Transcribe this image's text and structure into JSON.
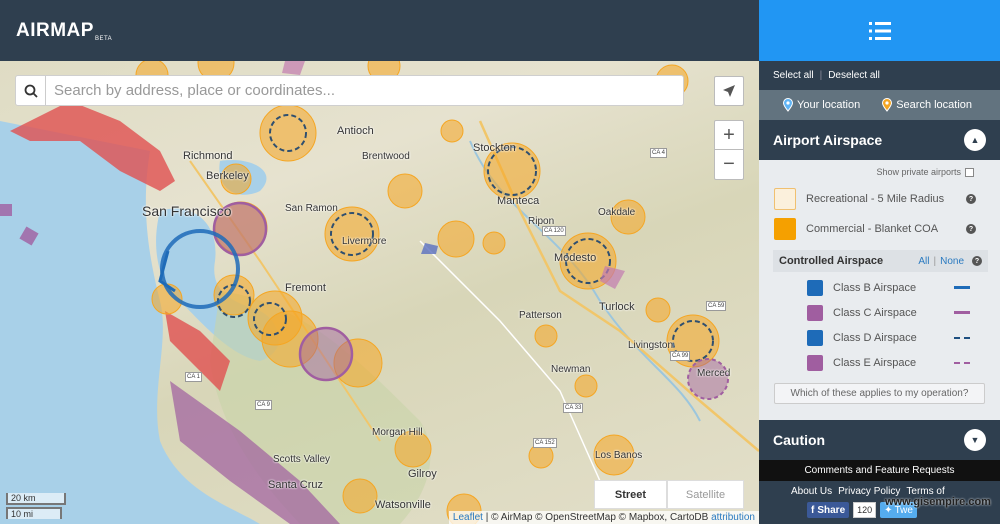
{
  "app": {
    "logo": "AIRMAP",
    "beta": "BETA"
  },
  "search": {
    "placeholder": "Search by address, place or coordinates..."
  },
  "map": {
    "controls": {
      "zoom_in": "+",
      "zoom_out": "−"
    },
    "places": [
      {
        "name": "Antioch",
        "kind": "city"
      },
      {
        "name": "Richmond",
        "kind": "city"
      },
      {
        "name": "Brentwood",
        "kind": "city"
      },
      {
        "name": "Stockton",
        "kind": "city"
      },
      {
        "name": "Berkeley",
        "kind": "city"
      },
      {
        "name": "San Francisco",
        "kind": "big"
      },
      {
        "name": "Manteca",
        "kind": "city"
      },
      {
        "name": "San Ramon",
        "kind": "city"
      },
      {
        "name": "Ripon",
        "kind": "city"
      },
      {
        "name": "Oakdale",
        "kind": "city"
      },
      {
        "name": "Livermore",
        "kind": "city"
      },
      {
        "name": "Modesto",
        "kind": "city"
      },
      {
        "name": "Fremont",
        "kind": "city"
      },
      {
        "name": "Turlock",
        "kind": "city"
      },
      {
        "name": "Patterson",
        "kind": "city"
      },
      {
        "name": "Livingston",
        "kind": "city"
      },
      {
        "name": "Newman",
        "kind": "city"
      },
      {
        "name": "Merced",
        "kind": "city"
      },
      {
        "name": "Morgan Hill",
        "kind": "city"
      },
      {
        "name": "Scotts Valley",
        "kind": "city"
      },
      {
        "name": "Gilroy",
        "kind": "city"
      },
      {
        "name": "Los Banos",
        "kind": "city"
      },
      {
        "name": "Santa Cruz",
        "kind": "city"
      },
      {
        "name": "Watsonville",
        "kind": "city"
      }
    ],
    "roads": [
      "CA 4",
      "CA 120",
      "CA 59",
      "CA 99",
      "CA 1",
      "CA 9",
      "CA 33",
      "CA 152"
    ],
    "layer_toggle": {
      "street": "Street",
      "satellite": "Satellite"
    },
    "scale": {
      "km": "20 km",
      "mi": "10 mi"
    },
    "attribution": {
      "leaflet": "Leaflet",
      "text": " | © AirMap © OpenStreetMap © Mapbox, CartoDB ",
      "link": "attribution"
    }
  },
  "sidebar": {
    "select_all": "Select all",
    "deselect_all": "Deselect all",
    "your_location": "Your location",
    "search_location": "Search location",
    "airport_section": "Airport Airspace",
    "show_private": "Show private airports",
    "rows": [
      {
        "label": "Recreational - 5 Mile Radius",
        "color": "#fbf0dc",
        "border": "#f0c070"
      },
      {
        "label": "Commercial - Blanket COA",
        "color": "#f5a000",
        "border": "#f5a000"
      }
    ],
    "controlled": {
      "title": "Controlled Airspace",
      "all": "All",
      "none": "None"
    },
    "classes": [
      {
        "label": "Class B Airspace",
        "color": "#1e6bb8",
        "line": "solid",
        "line_color": "#1e6bb8"
      },
      {
        "label": "Class C Airspace",
        "color": "#a05ea0",
        "line": "solid",
        "line_color": "#a05ea0"
      },
      {
        "label": "Class D Airspace",
        "color": "#1e6bb8",
        "line": "dashed",
        "line_color": "#1e4f80"
      },
      {
        "label": "Class E Airspace",
        "color": "#a05ea0",
        "line": "dashed",
        "line_color": "#a05ea0"
      }
    ],
    "which_button": "Which of these applies to my operation?",
    "caution": "Caution",
    "comments": "Comments and Feature Requests",
    "footer_links": [
      "About Us",
      "Privacy Policy",
      "Terms of"
    ],
    "share": {
      "facebook": "Share",
      "count": "120",
      "twitter": "Twe"
    }
  },
  "watermark": "www.gisempire.com"
}
